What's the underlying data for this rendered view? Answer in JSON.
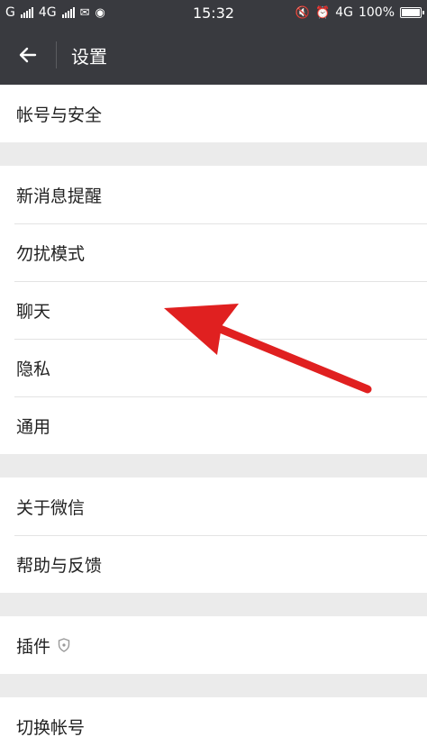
{
  "status_bar": {
    "carrier_1": "G",
    "carrier_2": "4G",
    "time": "15:32",
    "network": "4G",
    "battery": "100%",
    "battery_level": 1.0
  },
  "header": {
    "title": "设置"
  },
  "groups": [
    {
      "items": [
        {
          "label": "帐号与安全"
        }
      ]
    },
    {
      "items": [
        {
          "label": "新消息提醒"
        },
        {
          "label": "勿扰模式"
        },
        {
          "label": "聊天"
        },
        {
          "label": "隐私"
        },
        {
          "label": "通用"
        }
      ]
    },
    {
      "items": [
        {
          "label": "关于微信"
        },
        {
          "label": "帮助与反馈"
        }
      ]
    },
    {
      "items": [
        {
          "label": "插件"
        }
      ]
    },
    {
      "items": [
        {
          "label": "切换帐号"
        }
      ]
    }
  ],
  "colors": {
    "header_bg": "#393a3f",
    "page_bg": "#ebebeb",
    "arrow": "#e02020"
  },
  "icons": [
    "back-arrow-icon",
    "shield-icon",
    "alarm-icon",
    "mute-icon",
    "battery-icon",
    "signal-icon"
  ]
}
